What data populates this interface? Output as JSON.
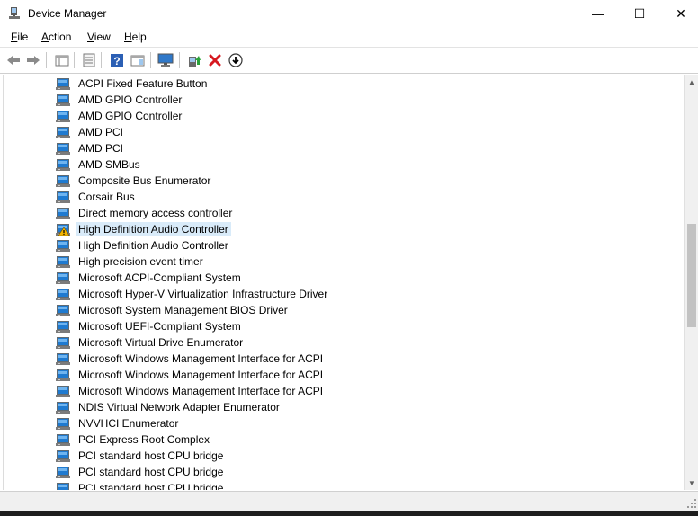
{
  "window": {
    "title": "Device Manager",
    "minimize_glyph": "—",
    "maximize_glyph": "☐",
    "close_glyph": "✕"
  },
  "menu": [
    {
      "first": "F",
      "rest": "ile"
    },
    {
      "first": "A",
      "rest": "ction"
    },
    {
      "first": "V",
      "rest": "iew"
    },
    {
      "first": "H",
      "rest": "elp"
    }
  ],
  "toolbar_icons": [
    "back-icon",
    "forward-icon",
    "properties-grid-icon",
    "device-list-icon",
    "help-icon",
    "action-panel-icon",
    "monitor-icon",
    "update-driver-icon",
    "uninstall-icon",
    "download-icon"
  ],
  "colors": {
    "selected_bg": "#d9ebf9",
    "warning": "#f2b400",
    "device_blue": "#1f7ad0"
  },
  "devices": [
    {
      "label": "ACPI Fixed Feature Button"
    },
    {
      "label": "AMD GPIO Controller"
    },
    {
      "label": "AMD GPIO Controller"
    },
    {
      "label": "AMD PCI"
    },
    {
      "label": "AMD PCI"
    },
    {
      "label": "AMD SMBus"
    },
    {
      "label": "Composite Bus Enumerator"
    },
    {
      "label": "Corsair Bus"
    },
    {
      "label": "Direct memory access controller"
    },
    {
      "label": "High Definition Audio Controller",
      "warning": true,
      "selected": true
    },
    {
      "label": "High Definition Audio Controller"
    },
    {
      "label": "High precision event timer"
    },
    {
      "label": "Microsoft ACPI-Compliant System"
    },
    {
      "label": "Microsoft Hyper-V Virtualization Infrastructure Driver"
    },
    {
      "label": "Microsoft System Management BIOS Driver"
    },
    {
      "label": "Microsoft UEFI-Compliant System"
    },
    {
      "label": "Microsoft Virtual Drive Enumerator"
    },
    {
      "label": "Microsoft Windows Management Interface for ACPI"
    },
    {
      "label": "Microsoft Windows Management Interface for ACPI"
    },
    {
      "label": "Microsoft Windows Management Interface for ACPI"
    },
    {
      "label": "NDIS Virtual Network Adapter Enumerator"
    },
    {
      "label": "NVVHCI Enumerator"
    },
    {
      "label": "PCI Express Root Complex"
    },
    {
      "label": "PCI standard host CPU bridge"
    },
    {
      "label": "PCI standard host CPU bridge"
    },
    {
      "label": "PCI standard host CPU bridge"
    }
  ]
}
